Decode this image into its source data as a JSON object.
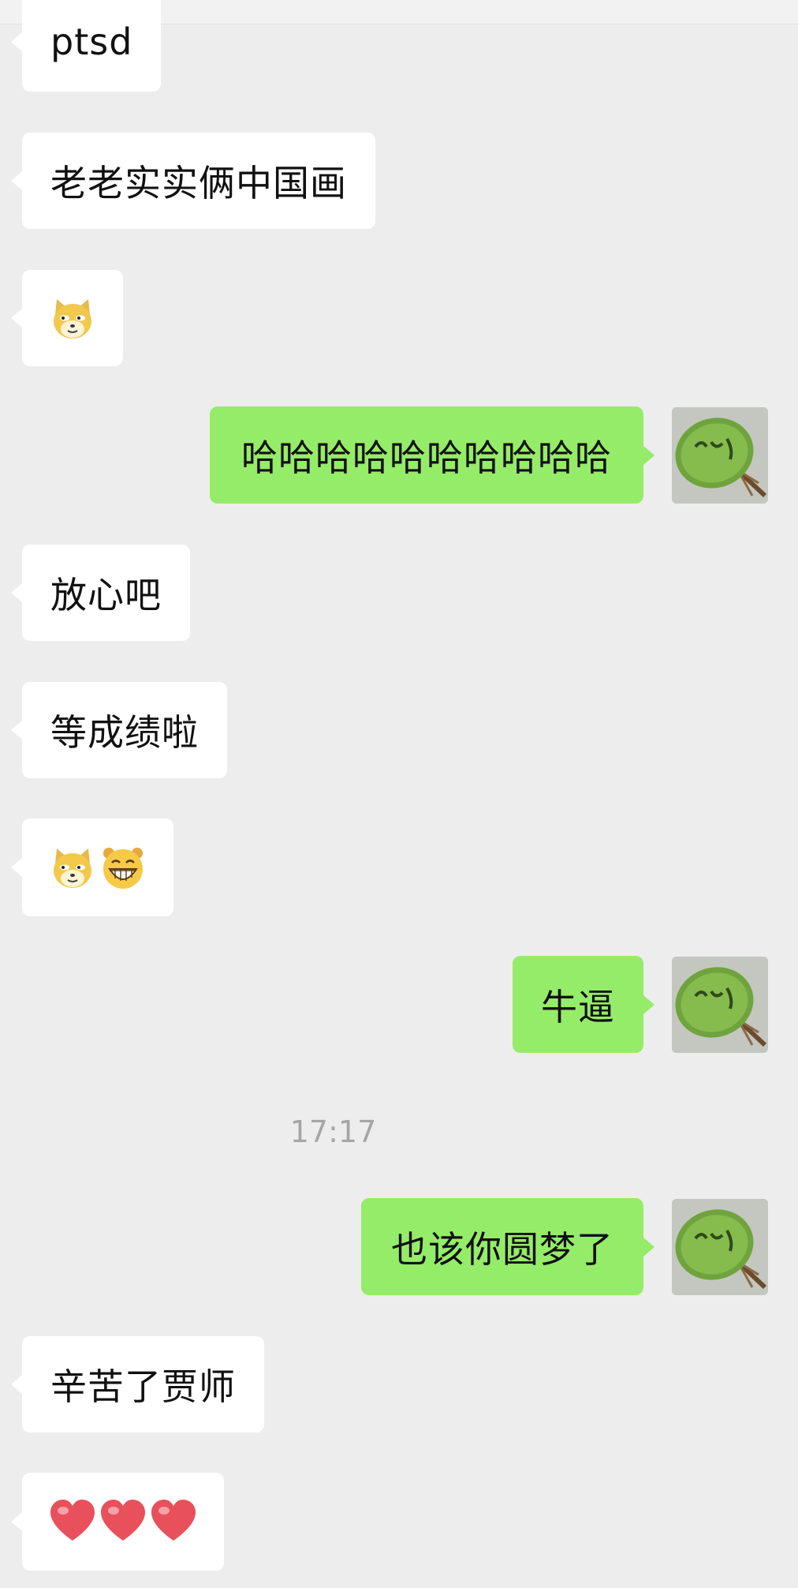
{
  "messages": [
    {
      "side": "left",
      "type": "text",
      "text": "ptsd"
    },
    {
      "side": "left",
      "type": "text",
      "text": "老老实实俩中国画"
    },
    {
      "side": "left",
      "type": "emoji",
      "emojis": [
        "doge-emoji"
      ]
    },
    {
      "side": "right",
      "type": "text",
      "text": "哈哈哈哈哈哈哈哈哈哈"
    },
    {
      "side": "left",
      "type": "text",
      "text": "放心吧"
    },
    {
      "side": "left",
      "type": "text",
      "text": "等成绩啦"
    },
    {
      "side": "left",
      "type": "emoji",
      "emojis": [
        "doge-emoji",
        "grin-emoji"
      ]
    },
    {
      "side": "right",
      "type": "text",
      "text": "牛逼"
    },
    {
      "type": "timestamp",
      "text": "17:17"
    },
    {
      "side": "right",
      "type": "text",
      "text": "也该你圆梦了"
    },
    {
      "side": "left",
      "type": "text",
      "text": "辛苦了贾师"
    },
    {
      "side": "left",
      "type": "emoji",
      "emojis": [
        "heart-emoji",
        "heart-emoji",
        "heart-emoji"
      ]
    }
  ],
  "colors": {
    "background": "#ededed",
    "left_bubble": "#ffffff",
    "right_bubble": "#95ec69",
    "timestamp": "#a5a5a5"
  }
}
